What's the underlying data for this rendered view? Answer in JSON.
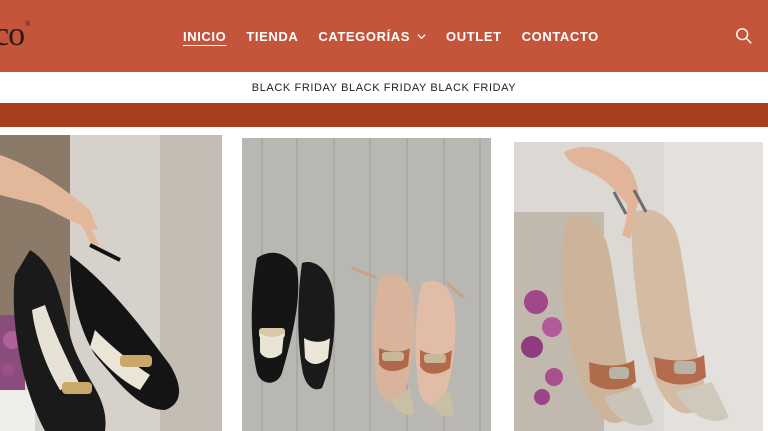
{
  "header": {
    "logo_text": "co",
    "logo_mark": "®",
    "nav": [
      {
        "label": "INICIO",
        "active": true
      },
      {
        "label": "TIENDA",
        "active": false
      },
      {
        "label": "CATEGORÍAS",
        "active": false,
        "has_dropdown": true
      },
      {
        "label": "OUTLET",
        "active": false
      },
      {
        "label": "CONTACTO",
        "active": false
      }
    ],
    "search_icon": "search-icon",
    "bg_color": "#c4553b"
  },
  "announcement": {
    "text": "BLACK FRIDAY BLACK FRIDAY BLACK FRIDAY"
  },
  "band_color": "#a83e1f",
  "gallery": {
    "images": [
      {
        "icon": "shoe-photo",
        "desc": "black and white slingback heels held by hand"
      },
      {
        "icon": "shoe-photo",
        "desc": "two pairs of slingback heels on wooden floor"
      },
      {
        "icon": "shoe-photo",
        "desc": "metallic slingback heels held by hand"
      }
    ]
  }
}
